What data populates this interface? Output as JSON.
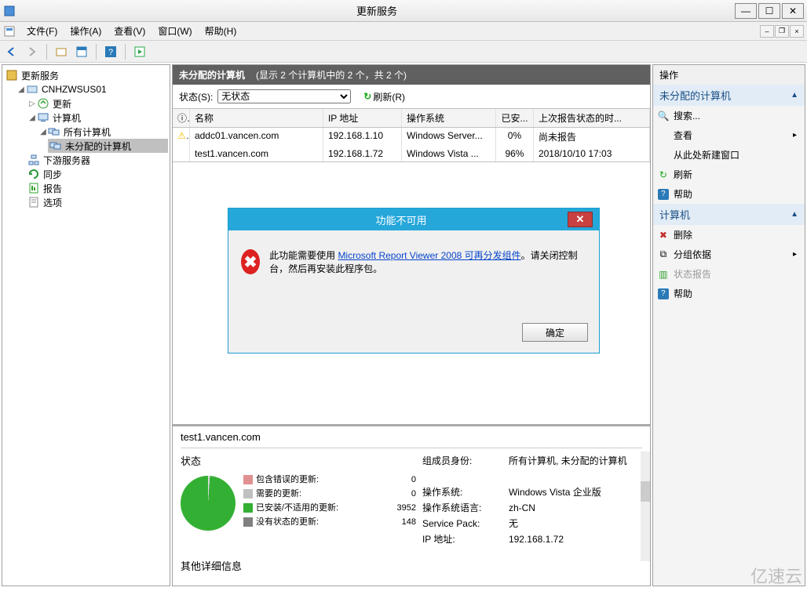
{
  "window": {
    "title": "更新服务"
  },
  "menubar": {
    "items": [
      "文件(F)",
      "操作(A)",
      "查看(V)",
      "窗口(W)",
      "帮助(H)"
    ]
  },
  "tree": {
    "root": "更新服务",
    "server": "CNHZWSUS01",
    "updates": "更新",
    "computers": "计算机",
    "all_computers": "所有计算机",
    "unassigned": "未分配的计算机",
    "downstream": "下游服务器",
    "sync": "同步",
    "report": "报告",
    "options": "选项"
  },
  "centerHeader": {
    "title": "未分配的计算机",
    "subtitle": "(显示 2 个计算机中的 2 个，共 2 个)"
  },
  "filter": {
    "state_label": "状态(S):",
    "state_value": "无状态",
    "refresh_label": "刷新(R)"
  },
  "columns": {
    "name": "名称",
    "ip": "IP 地址",
    "os": "操作系统",
    "installed": "已安...",
    "last_report": "上次报告状态的时..."
  },
  "rows": [
    {
      "warn": true,
      "name": "addc01.vancen.com",
      "ip": "192.168.1.10",
      "os": "Windows Server...",
      "inst": "0%",
      "last": "尚未报告"
    },
    {
      "warn": false,
      "name": "test1.vancen.com",
      "ip": "192.168.1.72",
      "os": "Windows Vista ...",
      "inst": "96%",
      "last": "2018/10/10 17:03"
    }
  ],
  "detail": {
    "host": "test1.vancen.com",
    "status_title": "状态",
    "legend": [
      {
        "label": "包含错误的更新:",
        "value": "0"
      },
      {
        "label": "需要的更新:",
        "value": "0"
      },
      {
        "label": "已安装/不适用的更新:",
        "value": "3952"
      },
      {
        "label": "没有状态的更新:",
        "value": "148"
      }
    ],
    "props": {
      "group_label": "组成员身份:",
      "group_value": "所有计算机, 未分配的计算机",
      "os_label": "操作系统:",
      "os_value": "Windows Vista 企业版",
      "oslang_label": "操作系统语言:",
      "oslang_value": "zh-CN",
      "sp_label": "Service Pack:",
      "sp_value": "无",
      "ip_label": "IP 地址:",
      "ip_value": "192.168.1.72"
    },
    "other": "其他详细信息"
  },
  "dialog": {
    "title": "功能不可用",
    "text_prefix": "此功能需要使用 ",
    "link_text": "Microsoft Report Viewer 2008 可再分发组件",
    "text_suffix": "。请关闭控制台，然后再安装此程序包。",
    "ok": "确定"
  },
  "actions": {
    "header": "操作",
    "section1": "未分配的计算机",
    "search": "搜索...",
    "view": "查看",
    "new_window": "从此处新建窗口",
    "refresh": "刷新",
    "help1": "帮助",
    "section2": "计算机",
    "delete": "删除",
    "group_by": "分组依据",
    "status_report": "状态报告",
    "help2": "帮助"
  },
  "watermark": "亿速云"
}
